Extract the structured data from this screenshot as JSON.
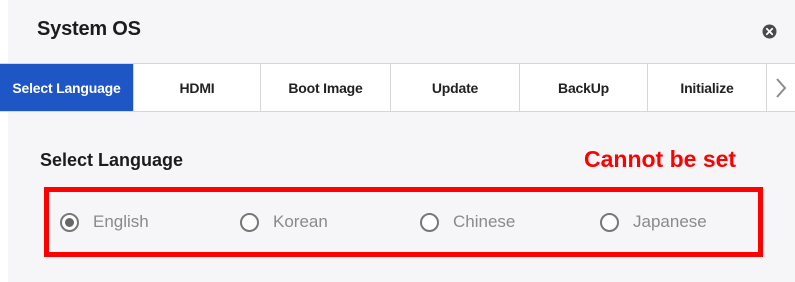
{
  "window": {
    "title": "System OS",
    "close_icon": "close-circle-icon"
  },
  "tabs": [
    {
      "label": "Select Language",
      "active": true
    },
    {
      "label": "HDMI",
      "active": false
    },
    {
      "label": "Boot Image",
      "active": false
    },
    {
      "label": "Update",
      "active": false
    },
    {
      "label": "BackUp",
      "active": false
    },
    {
      "label": "Initialize",
      "active": false
    }
  ],
  "tabs_next_icon": "chevron-right-icon",
  "section": {
    "title": "Select Language",
    "warning": "Cannot be set",
    "warning_color": "#ff0000"
  },
  "languages": {
    "selected": "English",
    "options": [
      "English",
      "Korean",
      "Chinese",
      "Japanese"
    ]
  },
  "colors": {
    "active_tab": "#1f56c6",
    "highlight_border": "#ff0000"
  }
}
